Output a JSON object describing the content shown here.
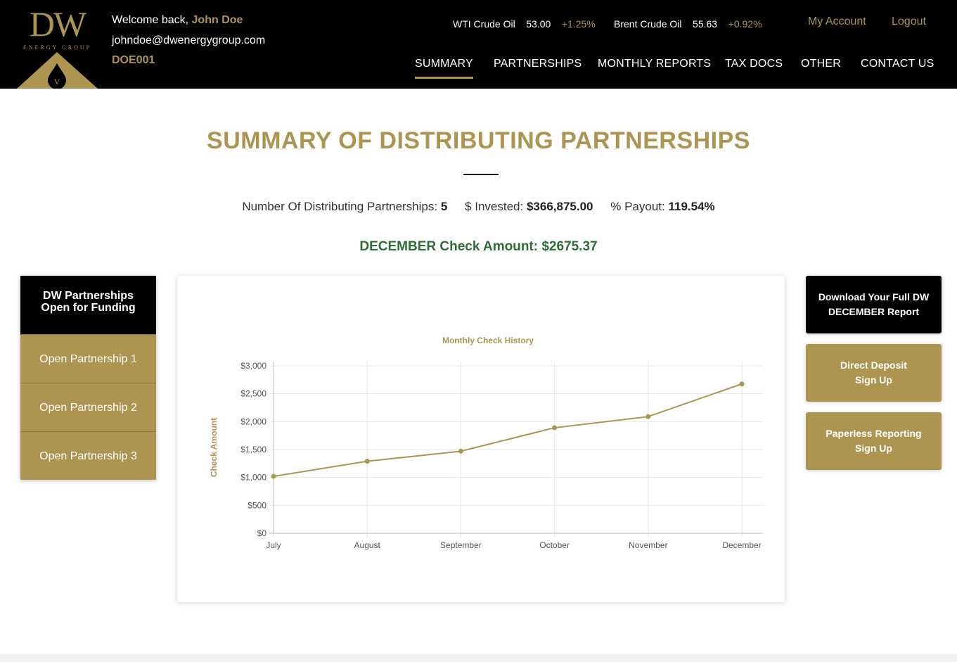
{
  "brand": {
    "logo_text": "DW",
    "logo_sub": "ENERGY GROUP",
    "logo_mark": "V",
    "accent": "#ad9551",
    "green": "#2e6e34"
  },
  "user": {
    "welcome_prefix": "Welcome back,",
    "name": "John Doe",
    "email": "johndoe@dwenergygroup.com",
    "account_id": "DOE001"
  },
  "ticker": [
    {
      "name": "WTI Crude Oil",
      "price": "53.00",
      "change": "+1.25%"
    },
    {
      "name": "Brent Crude Oil",
      "price": "55.63",
      "change": "+0.92%"
    }
  ],
  "top_links": {
    "account": "My Account",
    "logout": "Logout"
  },
  "nav": [
    "SUMMARY",
    "PARTNERSHIPS",
    "MONTHLY REPORTS",
    "TAX DOCS",
    "OTHER",
    "CONTACT US"
  ],
  "nav_active": "SUMMARY",
  "page_title": "SUMMARY OF DISTRIBUTING PARTNERSHIPS",
  "stats": {
    "count_label": "Number Of Distributing Partnerships:",
    "count_value": "5",
    "invested_label": "$ Invested:",
    "invested_value": "$366,875.00",
    "payout_label": "% Payout:",
    "payout_value": "119.54%"
  },
  "check_amount": "DECEMBER Check Amount: $2675.37",
  "left_panel": {
    "heading": "DW Partnerships Open for Funding",
    "items": [
      "Open Partnership 1",
      "Open Partnership 2",
      "Open Partnership 3"
    ]
  },
  "right_buttons": {
    "download": "Download Your Full DW DECEMBER Report",
    "direct_deposit": "Direct Deposit Sign Up",
    "paperless": "Paperless Reporting Sign Up"
  },
  "chart_data": {
    "type": "line",
    "title": "Monthly Check History",
    "xlabel": "",
    "ylabel": "Check Amount",
    "categories": [
      "July",
      "August",
      "September",
      "October",
      "November",
      "December"
    ],
    "values": [
      1020,
      1290,
      1470,
      1890,
      2090,
      2675.37
    ],
    "ylim": [
      0,
      3000
    ],
    "yticks": [
      0,
      500,
      1000,
      1500,
      2000,
      2500,
      3000
    ],
    "ytick_labels": [
      "$0",
      "$500",
      "$1,000",
      "$1,500",
      "$2,000",
      "$2,500",
      "$3,000"
    ],
    "grid": true,
    "color": "#ad9551"
  }
}
